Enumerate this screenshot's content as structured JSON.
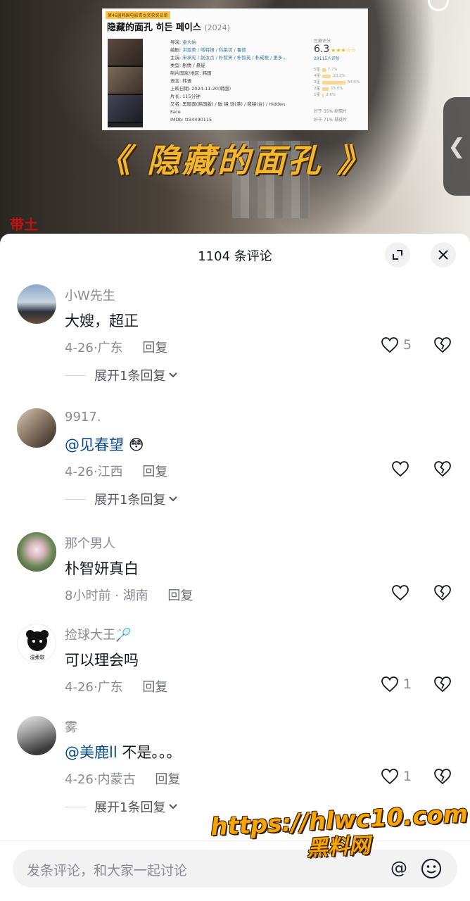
{
  "video": {
    "info_card": {
      "tag": "第46届韩国电影青龙奖获奖名单",
      "title": "隐藏的面孔 히든 페이스",
      "year": "(2024)",
      "meta": [
        {
          "label": "导演:",
          "value": "金大佑"
        },
        {
          "label": "编剧:",
          "value": "洪恩美 / 哈特姆 / 科莱切 / 鲁德"
        },
        {
          "label": "主演:",
          "value": "宋承宪 / 赵汝贞 / 朴智贤 / 朴智英 / 朴成根 / 更多..."
        },
        {
          "label": "类型:",
          "value": "剧情 / 悬疑"
        },
        {
          "label": "制片国家/地区:",
          "value": "韩国"
        },
        {
          "label": "语言:",
          "value": "韩语"
        },
        {
          "label": "上映日期:",
          "value": "2024-11-20(韩国)"
        },
        {
          "label": "片长:",
          "value": "115分钟"
        },
        {
          "label": "又名:",
          "value": "黑暗面(韩国版) / 破 镜 谜(港) / 窥镜(台) / Hidden"
        },
        {
          "label": "",
          "value": "Face"
        },
        {
          "label": "IMDb:",
          "value": "tt34490115"
        }
      ],
      "rating_label": "豆瓣评分",
      "score": "6.3",
      "stars": "★★★☆☆",
      "votes": "29115人评价",
      "distribution": [
        {
          "label": "5星",
          "pct": "7.7%",
          "value": 7.7
        },
        {
          "label": "4星",
          "pct": "20.2%",
          "value": 20.2
        },
        {
          "label": "3星",
          "pct": "54.5%",
          "value": 54.5
        },
        {
          "label": "2星",
          "pct": "15.0%",
          "value": 15.0
        },
        {
          "label": "1星",
          "pct": "2.6%",
          "value": 2.6
        }
      ],
      "better_1": "好于 55% 剧情片",
      "better_2": "好于 71% 悬疑片"
    },
    "banner": "《 隐藏的面孔 》",
    "corner_mark": "带土"
  },
  "sheet": {
    "title": "1104 条评论",
    "comments": [
      {
        "user": "小W先生",
        "text": "大嫂，超正",
        "mention": "",
        "emoji": "",
        "time": "4-26",
        "location": "广东",
        "reply_label": "回复",
        "likes": "5",
        "expand": "展开1条回复"
      },
      {
        "user": "9917.",
        "text": "",
        "mention": "@见春望",
        "emoji": "😳",
        "time": "4-26",
        "location": "江西",
        "reply_label": "回复",
        "likes": "",
        "expand": "展开1条回复"
      },
      {
        "user": "那个男人",
        "text": "朴智妍真白",
        "mention": "",
        "emoji": "",
        "time": "8小时前",
        "location": "湖南",
        "reply_label": "回复",
        "likes": "",
        "expand": ""
      },
      {
        "user": "捡球大王🏸",
        "text": "可以理会吗",
        "mention": "",
        "emoji": "",
        "time": "4-26",
        "location": "广东",
        "reply_label": "回复",
        "likes": "1",
        "expand": ""
      },
      {
        "user": "雾",
        "text": " 不是。。。",
        "mention": "@美鹿ll",
        "emoji": "",
        "time": "4-26",
        "location": "内蒙古",
        "reply_label": "回复",
        "likes": "1",
        "expand": "展开1条回复"
      }
    ],
    "avatar_caption_4": "湿柔软"
  },
  "input": {
    "placeholder": "发条评论，和大家一起讨论",
    "at_symbol": "@"
  },
  "watermark": {
    "line1": "https://hlwc10.com",
    "line2": "黑料网"
  },
  "colors": {
    "mention": "#04498d",
    "muted": "#8a8b91",
    "banner": "#f2b72e",
    "watermark": "#f7a600"
  }
}
